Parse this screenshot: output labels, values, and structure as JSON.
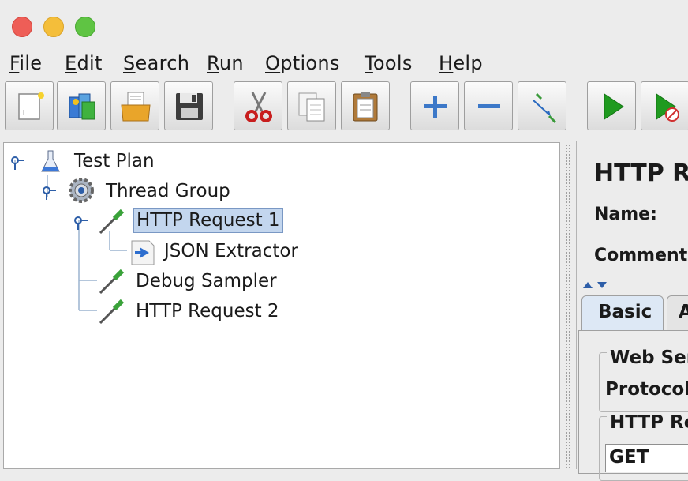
{
  "menu": [
    {
      "mnemonic": "F",
      "rest": "ile"
    },
    {
      "mnemonic": "E",
      "rest": "dit"
    },
    {
      "mnemonic": "S",
      "rest": "earch"
    },
    {
      "mnemonic": "R",
      "rest": "un"
    },
    {
      "mnemonic": "O",
      "rest": "ptions"
    },
    {
      "mnemonic": "T",
      "rest": "ools"
    },
    {
      "mnemonic": "H",
      "rest": "elp"
    }
  ],
  "toolbar": {
    "buttons": [
      "new-icon",
      "templates-icon",
      "open-icon",
      "save-icon",
      "cut-icon",
      "copy-icon",
      "paste-icon",
      "expand-icon",
      "collapse-icon",
      "toggle-icon",
      "start-icon",
      "start-no-pauses-icon"
    ]
  },
  "tree": {
    "nodes": [
      {
        "label": "Test Plan",
        "icon": "test-plan-flask-icon"
      },
      {
        "label": "Thread Group",
        "icon": "thread-group-gear-icon"
      },
      {
        "label": "HTTP Request 1",
        "icon": "sampler-pipette-icon",
        "selected": true
      },
      {
        "label": "JSON Extractor",
        "icon": "post-processor-icon"
      },
      {
        "label": "Debug Sampler",
        "icon": "sampler-pipette-icon"
      },
      {
        "label": "HTTP Request 2",
        "icon": "sampler-pipette-icon"
      }
    ]
  },
  "editor": {
    "title": "HTTP R",
    "name_label": "Name:",
    "comments_label": "Comment",
    "tabs": [
      "Basic",
      "A"
    ],
    "web_server_group": "Web Ser",
    "protocol_label": "Protocol",
    "http_request_group": "HTTP Re",
    "method_value": "GET"
  },
  "colors": {
    "selection_bg": "#c3d6ee",
    "tab_active_bg": "#dde8f5",
    "run_green": "#1f9a1f"
  }
}
